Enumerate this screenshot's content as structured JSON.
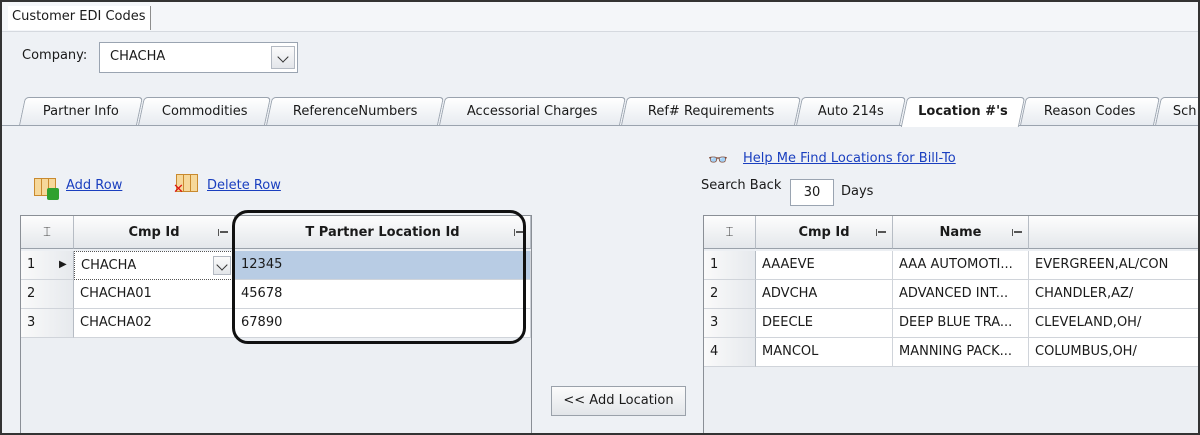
{
  "window": {
    "doc_tab": "Customer EDI Codes"
  },
  "company": {
    "label": "Company:",
    "value": "CHACHA"
  },
  "tabs": [
    {
      "label": "Partner Info"
    },
    {
      "label": "Commodities"
    },
    {
      "label": "ReferenceNumbers"
    },
    {
      "label": "Accessorial Charges"
    },
    {
      "label": "Ref# Requirements"
    },
    {
      "label": "Auto 214s"
    },
    {
      "label": "Location #'s"
    },
    {
      "label": "Reason Codes"
    },
    {
      "label": "Sch"
    }
  ],
  "left_toolbar": {
    "add_row": "Add Row",
    "delete_row": "Delete Row"
  },
  "left_grid": {
    "columns": [
      "Cmp Id",
      "T Partner Location Id"
    ],
    "rows": [
      {
        "num": "1",
        "cmp_id": "CHACHA",
        "loc_id": "12345"
      },
      {
        "num": "2",
        "cmp_id": "CHACHA01",
        "loc_id": "45678"
      },
      {
        "num": "3",
        "cmp_id": "CHACHA02",
        "loc_id": "67890"
      }
    ]
  },
  "add_location_button": "<< Add Location",
  "right_panel": {
    "help_link": "Help Me Find Locations for Bill-To",
    "search_back_label": "Search Back",
    "search_back_value": "30",
    "days_label": "Days"
  },
  "right_grid": {
    "columns": [
      "Cmp Id",
      "Name"
    ],
    "rows": [
      {
        "num": "1",
        "cmp_id": "AAAEVE",
        "name": "AAA AUTOMOTI...",
        "city": "EVERGREEN,AL/CON"
      },
      {
        "num": "2",
        "cmp_id": "ADVCHA",
        "name": "ADVANCED INT...",
        "city": "CHANDLER,AZ/"
      },
      {
        "num": "3",
        "cmp_id": "DEECLE",
        "name": "DEEP BLUE TRA...",
        "city": "CLEVELAND,OH/"
      },
      {
        "num": "4",
        "cmp_id": "MANCOL",
        "name": "MANNING PACK...",
        "city": "COLUMBUS,OH/"
      }
    ]
  }
}
